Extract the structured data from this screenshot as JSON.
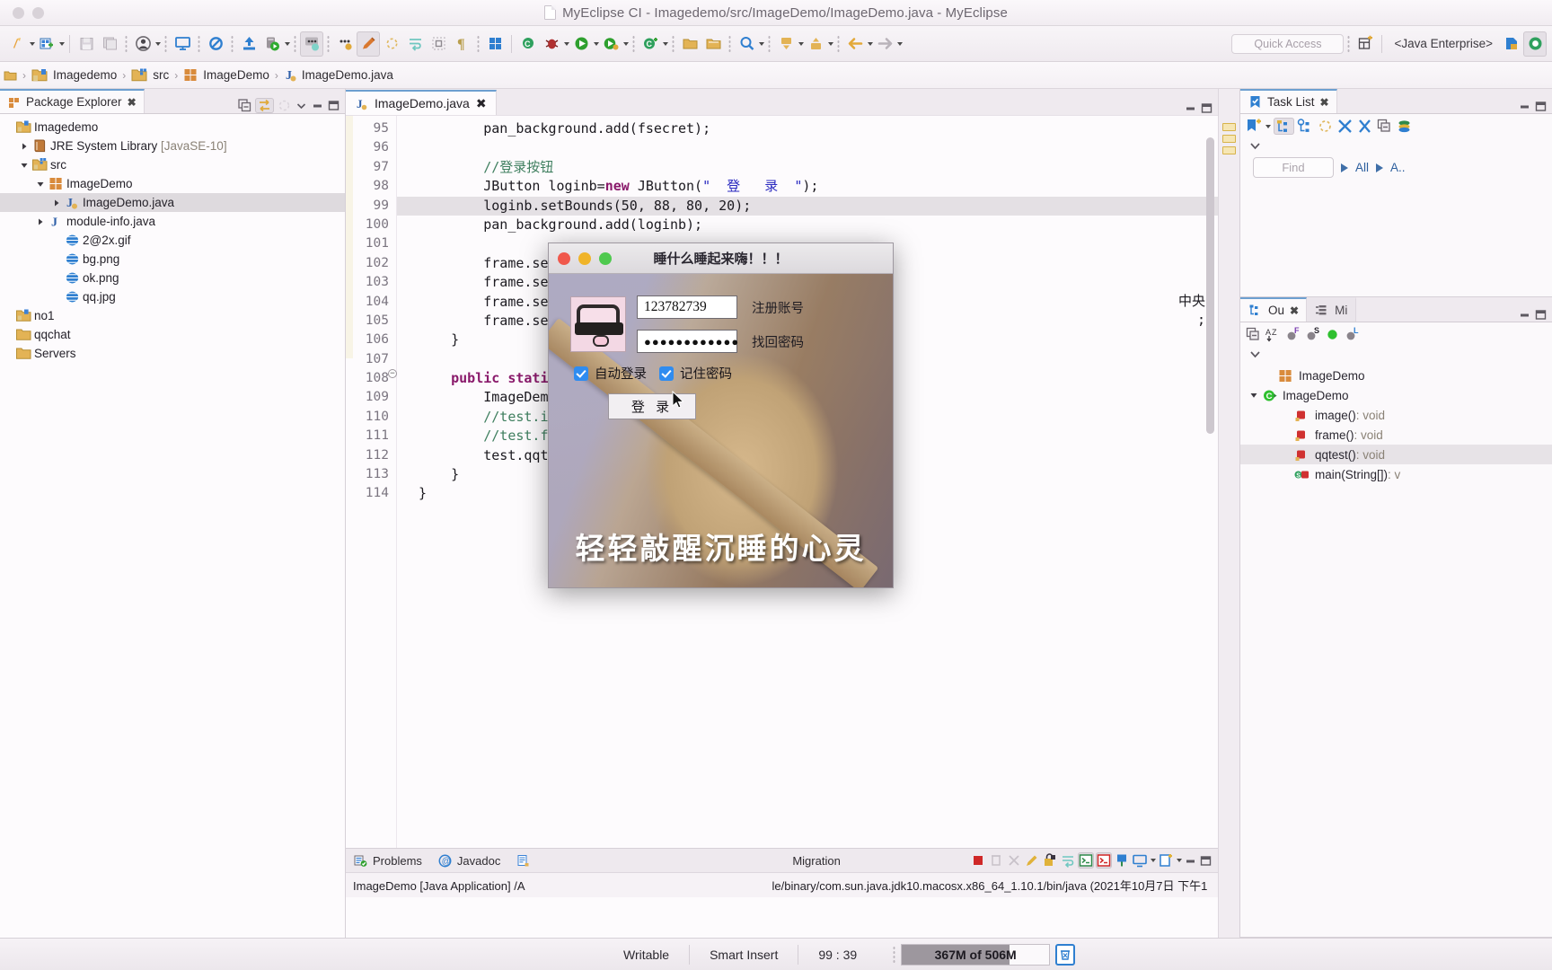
{
  "window": {
    "title": "MyEclipse CI - Imagedemo/src/ImageDemo/ImageDemo.java - MyEclipse"
  },
  "toolbar": {
    "quick_access_placeholder": "Quick Access",
    "perspective_label": "<Java Enterprise>"
  },
  "breadcrumb": {
    "items": [
      {
        "label": "Imagedemo",
        "icon": "project-folder-icon"
      },
      {
        "label": "src",
        "icon": "source-folder-icon"
      },
      {
        "label": "ImageDemo",
        "icon": "package-icon"
      },
      {
        "label": "ImageDemo.java",
        "icon": "java-file-icon"
      }
    ],
    "separator": "›"
  },
  "package_explorer": {
    "title": "Package Explorer",
    "close_glyph": "✖",
    "tree": [
      {
        "label": "Imagedemo",
        "indent": 0,
        "arrow": "none",
        "icon": "project-folder-icon",
        "selected": false
      },
      {
        "label": "JRE System Library ",
        "suffix": "[JavaSE-10]",
        "indent": 1,
        "arrow": "collapsed",
        "icon": "library-icon",
        "selected": false
      },
      {
        "label": "src",
        "indent": 1,
        "arrow": "expanded",
        "icon": "source-folder-icon",
        "selected": false
      },
      {
        "label": "ImageDemo",
        "indent": 2,
        "arrow": "expanded",
        "icon": "package-icon",
        "selected": false
      },
      {
        "label": "ImageDemo.java",
        "indent": 3,
        "arrow": "collapsed",
        "icon": "java-file-icon",
        "selected": true
      },
      {
        "label": "module-info.java",
        "indent": 2,
        "arrow": "collapsed",
        "icon": "java-module-icon",
        "selected": false
      },
      {
        "label": "2@2x.gif",
        "indent": 3,
        "arrow": "none",
        "icon": "globe-resource-icon",
        "selected": false
      },
      {
        "label": "bg.png",
        "indent": 3,
        "arrow": "none",
        "icon": "globe-resource-icon",
        "selected": false
      },
      {
        "label": "ok.png",
        "indent": 3,
        "arrow": "none",
        "icon": "globe-resource-icon",
        "selected": false
      },
      {
        "label": "qq.jpg",
        "indent": 3,
        "arrow": "none",
        "icon": "globe-resource-icon",
        "selected": false
      },
      {
        "label": "no1",
        "indent": 0,
        "arrow": "none",
        "icon": "project-folder-icon",
        "selected": false
      },
      {
        "label": "qqchat",
        "indent": 0,
        "arrow": "none",
        "icon": "plain-folder-icon",
        "selected": false
      },
      {
        "label": "Servers",
        "indent": 0,
        "arrow": "none",
        "icon": "plain-folder-icon",
        "selected": false
      }
    ]
  },
  "editor": {
    "tab_label": "ImageDemo.java",
    "tab_close_glyph": "✖",
    "first_line_number": 95,
    "lines": [
      {
        "n": 95,
        "text": "        pan_background.add(fsecret);",
        "highlight": false,
        "fold": false
      },
      {
        "n": 96,
        "text": "",
        "highlight": false,
        "fold": false
      },
      {
        "n": 97,
        "text": "        //登录按钮",
        "highlight": false,
        "fold": false,
        "style": "comment"
      },
      {
        "n": 98,
        "text": "        JButton loginb=new JButton(\"  登   录  \");",
        "highlight": false,
        "fold": false,
        "style": "jbutton"
      },
      {
        "n": 99,
        "text": "        loginb.setBounds(50, 88, 80, 20);",
        "highlight": true,
        "fold": false
      },
      {
        "n": 100,
        "text": "        pan_background.add(loginb);",
        "highlight": false,
        "fold": false
      },
      {
        "n": 101,
        "text": "",
        "highlight": false,
        "fold": false
      },
      {
        "n": 102,
        "text": "        frame.setS",
        "highlight": false,
        "fold": false
      },
      {
        "n": 103,
        "text": "        frame.setL",
        "highlight": false,
        "fold": false
      },
      {
        "n": 104,
        "text": "        frame.setD",
        "highlight": false,
        "fold": false
      },
      {
        "n": 105,
        "text": "        frame.setV",
        "highlight": false,
        "fold": false
      },
      {
        "n": 106,
        "text": "    }",
        "highlight": false,
        "fold": false
      },
      {
        "n": 107,
        "text": "",
        "highlight": false,
        "fold": false
      },
      {
        "n": 108,
        "text": "    public static",
        "highlight": false,
        "fold": true,
        "style": "publicstatic"
      },
      {
        "n": 109,
        "text": "        ImageDemo",
        "highlight": false,
        "fold": false
      },
      {
        "n": 110,
        "text": "        //test.ima",
        "highlight": false,
        "fold": false,
        "style": "comment"
      },
      {
        "n": 111,
        "text": "        //test.fra",
        "highlight": false,
        "fold": false,
        "style": "comment"
      },
      {
        "n": 112,
        "text": "        test.qqtes",
        "highlight": false,
        "fold": false
      },
      {
        "n": 113,
        "text": "    }",
        "highlight": false,
        "fold": false
      },
      {
        "n": 114,
        "text": "}",
        "highlight": false,
        "fold": false
      }
    ],
    "right_hint_text": "中央",
    "right_hint_semicolon": ";"
  },
  "console": {
    "tabs": [
      {
        "label": "Problems",
        "icon": "problems-icon",
        "active": false
      },
      {
        "label": "Javadoc",
        "icon": "javadoc-at-icon",
        "active": false
      },
      {
        "label": "",
        "icon": "declaration-icon",
        "active": false
      },
      {
        "label": "Migration",
        "icon": "migration-icon",
        "active": false
      }
    ],
    "launch_line_left": "ImageDemo [Java Application] /A",
    "launch_line_right": "le/binary/com.sun.java.jdk10.macosx.x86_64_1.10.1/bin/java (2021年10月7日 下午1"
  },
  "task_list": {
    "title": "Task List",
    "close_glyph": "✖",
    "find_placeholder": "Find",
    "filter_all": "All",
    "filter_activate": "A.."
  },
  "outline": {
    "tab_label": "Ou",
    "tab_close_glyph": "✖",
    "second_tab_label": "Mi",
    "items": [
      {
        "label": "ImageDemo",
        "icon": "package-icon",
        "indent": 1,
        "arrow": "none",
        "selected": false,
        "ret": ""
      },
      {
        "label": "ImageDemo",
        "icon": "class-icon",
        "indent": 0,
        "arrow": "expanded",
        "selected": false,
        "ret": ""
      },
      {
        "label": "image()",
        "icon": "method-private-icon",
        "indent": 2,
        "arrow": "none",
        "selected": false,
        "ret": " : void"
      },
      {
        "label": "frame()",
        "icon": "method-private-icon",
        "indent": 2,
        "arrow": "none",
        "selected": false,
        "ret": " : void"
      },
      {
        "label": "qqtest()",
        "icon": "method-private-icon",
        "indent": 2,
        "arrow": "none",
        "selected": true,
        "ret": " : void"
      },
      {
        "label": "main(String[])",
        "icon": "method-static-icon",
        "indent": 2,
        "arrow": "none",
        "selected": false,
        "ret": " : v"
      }
    ]
  },
  "status_bar": {
    "writable": "Writable",
    "insert_mode": "Smart Insert",
    "cursor_position": "99 : 39",
    "memory": "367M of 506M",
    "memory_used_percent": 73,
    "trash_glyph": "🗑"
  },
  "qq_dialog": {
    "title": "睡什么睡起来嗨！！！",
    "traffic_lights": [
      "close",
      "minimize",
      "zoom"
    ],
    "account_value": "123782739",
    "password_value": "●●●●●●●●●●●●",
    "register_link": "注册账号",
    "forgot_link": "找回密码",
    "auto_login_label": "自动登录",
    "auto_login_checked": true,
    "remember_password_label": "记住密码",
    "remember_password_checked": true,
    "login_button": "登 录",
    "subtitle": "轻轻敲醒沉睡的心灵",
    "avatar_icon": "pig-avatar-icon"
  },
  "colors": {
    "accent_blue": "#2f8cf0",
    "tab_active_top": "#6d9fd0",
    "comment_green": "#3f7f5f",
    "keyword_purple": "#8a1a6b",
    "string_blue": "#2a2ac0"
  }
}
